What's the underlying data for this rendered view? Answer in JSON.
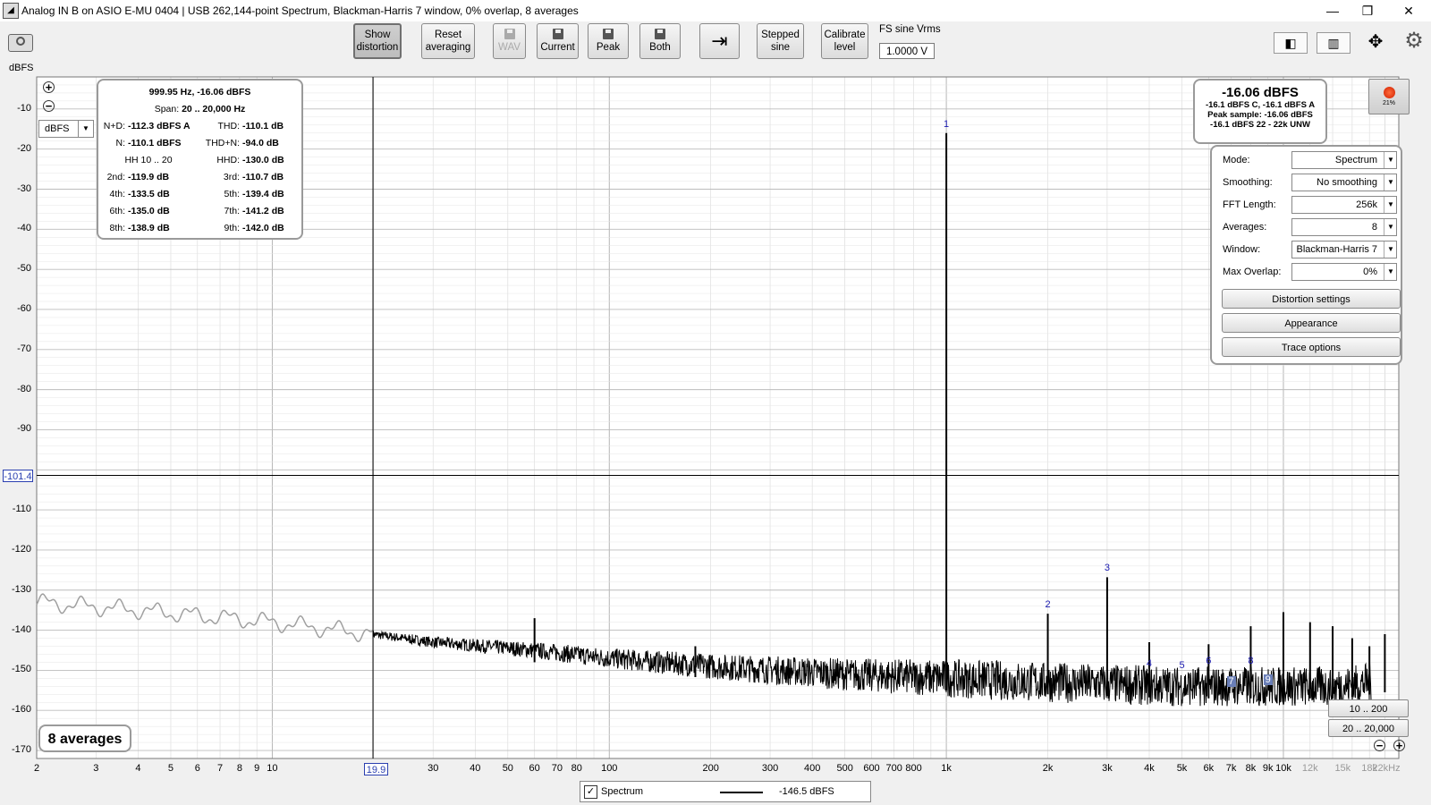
{
  "window": {
    "title": "Analog IN B on ASIO E-MU 0404 | USB 262,144-point Spectrum, Blackman-Harris 7 window, 0% overlap, 8 averages",
    "minimize": "—",
    "maximize": "❐",
    "close": "✕"
  },
  "toolbar": {
    "show_distortion_1": "Show",
    "show_distortion_2": "distortion",
    "reset_averaging_1": "Reset",
    "reset_averaging_2": "averaging",
    "wav": "WAV",
    "current": "Current",
    "peak": "Peak",
    "both": "Both",
    "stepped_sine_1": "Stepped",
    "stepped_sine_2": "sine",
    "calibrate_level_1": "Calibrate",
    "calibrate_level_2": "level",
    "fs_label": "FS sine Vrms",
    "fs_value": "1.0000 V"
  },
  "y_unit": "dBFS",
  "unit_select": "dBFS",
  "distortion": {
    "header": "999.95 Hz, -16.06 dBFS",
    "span_label": "Span:",
    "span_value": "20 .. 20,000 Hz",
    "rows": [
      [
        "N+D:",
        "-112.3 dBFS A",
        "THD:",
        "-110.1 dB"
      ],
      [
        "N:",
        "-110.1 dBFS",
        "THD+N:",
        "-94.0 dB"
      ],
      [
        "HH 10 .. 20",
        "",
        "HHD:",
        "-130.0 dB"
      ],
      [
        "2nd:",
        "-119.9 dB",
        "3rd:",
        "-110.7 dB"
      ],
      [
        "4th:",
        "-133.5 dB",
        "5th:",
        "-139.4 dB"
      ],
      [
        "6th:",
        "-135.0 dB",
        "7th:",
        "-141.2 dB"
      ],
      [
        "8th:",
        "-138.9 dB",
        "9th:",
        "-142.0 dB"
      ]
    ]
  },
  "level": {
    "main": "-16.06 dBFS",
    "line1": "-16.1 dBFS C, -16.1 dBFS A",
    "line2": "Peak sample: -16.06 dBFS",
    "line3": "-16.1 dBFS 22 - 22k UNW"
  },
  "record": {
    "percent": "21%"
  },
  "settings": {
    "mode_label": "Mode:",
    "mode": "Spectrum",
    "smoothing_label": "Smoothing:",
    "smoothing": "No  smoothing",
    "fft_label": "FFT Length:",
    "fft": "256k",
    "averages_label": "Averages:",
    "averages": "8",
    "window_label": "Window:",
    "window": "Blackman-Harris 7",
    "overlap_label": "Max Overlap:",
    "overlap": "0%",
    "distortion_settings": "Distortion settings",
    "appearance": "Appearance",
    "trace_options": "Trace options"
  },
  "averages_badge": "8 averages",
  "range_buttons": [
    "10 .. 200",
    "20 .. 20,000"
  ],
  "cursor": {
    "y_value": "-101.4",
    "x_value": "19.9"
  },
  "legend": {
    "name": "Spectrum",
    "value": "-146.5 dBFS",
    "checked": "✓"
  },
  "colors": {
    "trace": "#000000",
    "pre_cursor_trace": "#a0a0a0",
    "harmonic_label": "#1a1ab0",
    "grid": "#d8d8d8"
  },
  "chart_data": {
    "type": "line",
    "title": "",
    "xlabel": "",
    "ylabel": "dBFS",
    "x_scale": "log",
    "xlim": [
      2,
      22000
    ],
    "ylim": [
      -172,
      -2
    ],
    "y_ticks": [
      -10,
      -20,
      -30,
      -40,
      -50,
      -60,
      -70,
      -80,
      -90,
      -100,
      -110,
      -120,
      -130,
      -140,
      -150,
      -160,
      -170
    ],
    "y_tick_labels": [
      "-10",
      "-20",
      "-30",
      "-40",
      "-50",
      "-60",
      "-70",
      "-80",
      "-90",
      "",
      "-110",
      "-120",
      "-130",
      "-140",
      "-150",
      "-160",
      "-170"
    ],
    "x_ticks": [
      2,
      3,
      4,
      5,
      6,
      7,
      8,
      9,
      10,
      30,
      40,
      50,
      60,
      70,
      80,
      100,
      200,
      300,
      400,
      500,
      600,
      700,
      800,
      1000,
      2000,
      3000,
      4000,
      5000,
      6000,
      7000,
      8000,
      9000,
      10000,
      12000,
      15000,
      18000,
      22000
    ],
    "x_tick_labels": [
      "2",
      "3",
      "4",
      "5",
      "6",
      "7",
      "8",
      "9",
      "10",
      "30",
      "40",
      "50",
      "60",
      "70",
      "80",
      "100",
      "200",
      "300",
      "400",
      "500",
      "600",
      "700",
      "800",
      "1k",
      "2k",
      "3k",
      "4k",
      "5k",
      "6k",
      "7k",
      "8k",
      "9k",
      "10k",
      "12k",
      "15k",
      "18k",
      "22kHz"
    ],
    "noise_floor": {
      "x": [
        2,
        4,
        10,
        19.9,
        30,
        60,
        100,
        200,
        500,
        1000,
        2000,
        5000,
        10000,
        15000,
        22000
      ],
      "y": [
        -133,
        -135,
        -138,
        -141,
        -143,
        -145,
        -147,
        -149,
        -151,
        -152,
        -153,
        -154,
        -154,
        -154,
        -152
      ]
    },
    "peaks": [
      {
        "x": 60,
        "y": -137
      },
      {
        "x": 180,
        "y": -144
      },
      {
        "x": 1000,
        "y": -16
      },
      {
        "x": 2000,
        "y": -135.9
      },
      {
        "x": 3000,
        "y": -126.8
      },
      {
        "x": 4000,
        "y": -143
      },
      {
        "x": 6000,
        "y": -143.5
      },
      {
        "x": 8000,
        "y": -139
      },
      {
        "x": 10000,
        "y": -135.5
      },
      {
        "x": 12000,
        "y": -138
      },
      {
        "x": 14000,
        "y": -139
      },
      {
        "x": 16000,
        "y": -142
      },
      {
        "x": 18000,
        "y": -144
      },
      {
        "x": 20000,
        "y": -141
      }
    ],
    "harmonic_markers": [
      {
        "label": "1",
        "x": 1000,
        "y": -16
      },
      {
        "label": "2",
        "x": 2000,
        "y": -135.9
      },
      {
        "label": "3",
        "x": 3000,
        "y": -126.8
      },
      {
        "label": "4",
        "x": 4000,
        "y": -150.5
      },
      {
        "label": "5",
        "x": 5000,
        "y": -151
      },
      {
        "label": "6",
        "x": 6000,
        "y": -150
      },
      {
        "label": "7",
        "x": 7000,
        "y": -155
      },
      {
        "label": "8",
        "x": 8000,
        "y": -150
      },
      {
        "label": "9",
        "x": 9000,
        "y": -154.5
      }
    ],
    "cursor": {
      "x": 19.9,
      "y": -101.4
    }
  }
}
